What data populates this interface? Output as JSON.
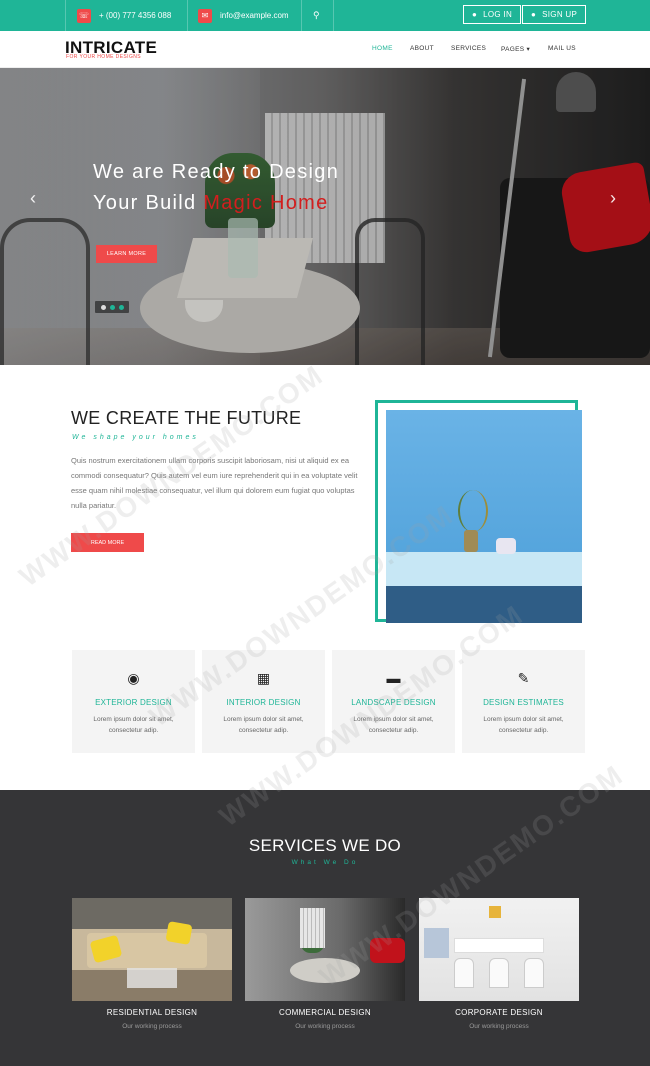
{
  "topbar": {
    "phone": "+ (00) 777 4356 088",
    "phone_icon": "phone-icon",
    "email": "info@example.com",
    "email_icon": "envelope-icon",
    "search_icon": "search-icon",
    "login_label": "LOG IN",
    "signup_label": "SIGN UP",
    "accent": "#1fb597"
  },
  "header": {
    "logo": "INTRICATE",
    "tagline": "FOR YOUR HOME DESIGNS",
    "nav": {
      "home": "HOME",
      "about": "ABOUT",
      "services": "SERVICES",
      "pages": "PAGES",
      "mail": "MAIL US"
    }
  },
  "hero": {
    "line1": "We are Ready to Design",
    "line2_start": "Your Build ",
    "line2_red": "Magic Home",
    "button": "LEARN MORE",
    "prev_icon": "chevron-left-icon",
    "next_icon": "chevron-right-icon"
  },
  "about": {
    "title": "WE CREATE THE FUTURE",
    "subtitle": "We shape your homes",
    "body": "Quis nostrum exercitationem ullam corporis suscipit laboriosam, nisi ut aliquid ex ea commodi consequatur? Quis autem vel eum iure reprehenderit qui in ea voluptate velit esse quam nihil molestiae consequatur, vel illum qui dolorem eum fugiat quo voluptas nulla pariatur.",
    "button": "READ MORE"
  },
  "features": [
    {
      "icon": "eye-icon",
      "title": "EXTERIOR DESIGN",
      "desc1": "Lorem ipsum dolor sit amet,",
      "desc2": "consectetur adip."
    },
    {
      "icon": "building-icon",
      "title": "INTERIOR DESIGN",
      "desc1": "Lorem ipsum dolor sit amet,",
      "desc2": "consectetur adip."
    },
    {
      "icon": "eraser-icon",
      "title": "LANDSCAPE DESIGN",
      "desc1": "Lorem ipsum dolor sit amet,",
      "desc2": "consectetur adip."
    },
    {
      "icon": "edit-icon",
      "title": "DESIGN ESTIMATES",
      "desc1": "Lorem ipsum dolor sit amet,",
      "desc2": "consectetur adip."
    }
  ],
  "services": {
    "title": "SERVICES WE DO",
    "subtitle": "What We Do",
    "cards": [
      {
        "title": "RESIDENTIAL DESIGN",
        "sub": "Our working process"
      },
      {
        "title": "COMMERCIAL DESIGN",
        "sub": "Our working process"
      },
      {
        "title": "CORPORATE DESIGN",
        "sub": "Our working process"
      }
    ]
  },
  "watermark": "WWW.DOWNDEMO.COM"
}
